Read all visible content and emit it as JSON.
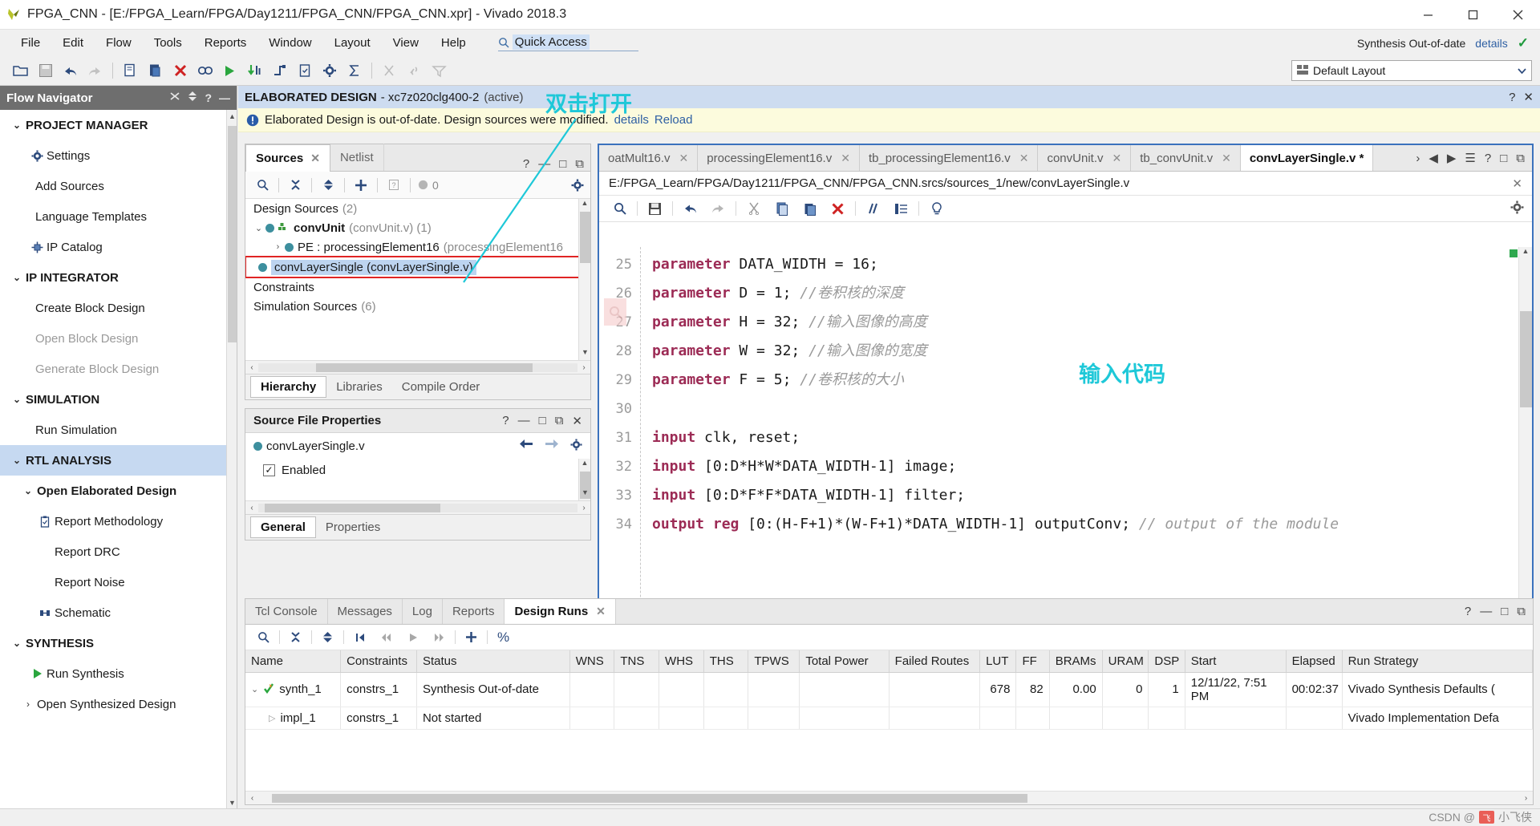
{
  "window": {
    "title": "FPGA_CNN - [E:/FPGA_Learn/FPGA/Day1211/FPGA_CNN/FPGA_CNN.xpr] - Vivado 2018.3",
    "minimize": "–",
    "maximize": "□",
    "close": "✕"
  },
  "menubar": {
    "items": [
      "File",
      "Edit",
      "Flow",
      "Tools",
      "Reports",
      "Window",
      "Layout",
      "View",
      "Help"
    ],
    "quick_access_value": "Quick Access",
    "synthesis_status": "Synthesis Out-of-date",
    "details_label": "details"
  },
  "toolbar": {
    "layout_label": "Default Layout"
  },
  "flow_navigator": {
    "header": "Flow Navigator",
    "sections": [
      {
        "label": "PROJECT MANAGER",
        "expanded": true,
        "items": [
          {
            "label": "Settings",
            "icon": "gear-icon",
            "disabled": false
          },
          {
            "label": "Add Sources",
            "icon": "",
            "disabled": false
          },
          {
            "label": "Language Templates",
            "icon": "",
            "disabled": false
          },
          {
            "label": "IP Catalog",
            "icon": "ip-icon",
            "disabled": false
          }
        ]
      },
      {
        "label": "IP INTEGRATOR",
        "expanded": true,
        "items": [
          {
            "label": "Create Block Design",
            "icon": "",
            "disabled": false
          },
          {
            "label": "Open Block Design",
            "icon": "",
            "disabled": true
          },
          {
            "label": "Generate Block Design",
            "icon": "",
            "disabled": true
          }
        ]
      },
      {
        "label": "SIMULATION",
        "expanded": true,
        "items": [
          {
            "label": "Run Simulation",
            "icon": "",
            "disabled": false
          }
        ]
      },
      {
        "label": "RTL ANALYSIS",
        "expanded": true,
        "selected": true,
        "items": [
          {
            "label": "Open Elaborated Design",
            "icon": "caret",
            "disabled": false,
            "bold": true
          },
          {
            "label": "Report Methodology",
            "icon": "clipboard-icon",
            "disabled": false
          },
          {
            "label": "Report DRC",
            "icon": "",
            "disabled": false
          },
          {
            "label": "Report Noise",
            "icon": "",
            "disabled": false
          },
          {
            "label": "Schematic",
            "icon": "schematic-icon",
            "disabled": false
          }
        ]
      },
      {
        "label": "SYNTHESIS",
        "expanded": true,
        "items": [
          {
            "label": "Run Synthesis",
            "icon": "run-icon",
            "disabled": false
          },
          {
            "label": "Open Synthesized Design",
            "icon": "caret",
            "disabled": false
          }
        ]
      }
    ]
  },
  "elaborated_header": {
    "title": "ELABORATED DESIGN",
    "device": "- xc7z020clg400-2",
    "active": "(active)"
  },
  "warning_bar": {
    "message": "Elaborated Design is out-of-date. Design sources were modified.",
    "details_label": "details",
    "reload_label": "Reload"
  },
  "sources_panel": {
    "tabs": [
      {
        "label": "Sources",
        "active": true,
        "closable": true
      },
      {
        "label": "Netlist",
        "active": false,
        "closable": false
      }
    ],
    "toolbar_badge": "0",
    "tree": [
      {
        "label": "Design Sources",
        "count": "(2)",
        "indent": 0,
        "arrow": "",
        "dot": false
      },
      {
        "label": "convUnit",
        "sub": "(convUnit.v) (1)",
        "indent": 0,
        "arrow": "v",
        "dot": true,
        "bold": true,
        "module": true
      },
      {
        "label": "PE : processingElement16",
        "sub": "(processingElement16",
        "indent": 1,
        "arrow": ">",
        "dot": true
      },
      {
        "label": "convLayerSingle (convLayerSingle.v)",
        "sub": "",
        "indent": 0,
        "arrow": "",
        "dot": true,
        "selected": true,
        "highlighted": true
      },
      {
        "label": "Constraints",
        "sub": "",
        "indent": 0,
        "arrow": "",
        "dot": false
      },
      {
        "label": "Simulation Sources",
        "count": "(6)",
        "indent": 0,
        "arrow": "",
        "dot": false
      }
    ],
    "subtabs": [
      {
        "label": "Hierarchy",
        "active": true
      },
      {
        "label": "Libraries",
        "active": false
      },
      {
        "label": "Compile Order",
        "active": false
      }
    ]
  },
  "properties_panel": {
    "title": "Source File Properties",
    "file_name": "convLayerSingle.v",
    "enabled_label": "Enabled",
    "enabled_checked": true,
    "subtabs": [
      {
        "label": "General",
        "active": true
      },
      {
        "label": "Properties",
        "active": false
      }
    ]
  },
  "editor": {
    "tabs": [
      {
        "label": "oatMult16.v",
        "active": false,
        "modified": false
      },
      {
        "label": "processingElement16.v",
        "active": false,
        "modified": false
      },
      {
        "label": "tb_processingElement16.v",
        "active": false,
        "modified": false
      },
      {
        "label": "convUnit.v",
        "active": false,
        "modified": false
      },
      {
        "label": "tb_convUnit.v",
        "active": false,
        "modified": false
      },
      {
        "label": "convLayerSingle.v *",
        "active": true,
        "modified": true
      }
    ],
    "file_path": "E:/FPGA_Learn/FPGA/Day1211/FPGA_CNN/FPGA_CNN.srcs/sources_1/new/convLayerSingle.v",
    "lines": [
      {
        "no": "25",
        "parts": [
          {
            "t": "parameter",
            "c": "kw"
          },
          {
            "t": " DATA_WIDTH = 16;",
            "c": ""
          }
        ]
      },
      {
        "no": "26",
        "parts": [
          {
            "t": "parameter",
            "c": "kw"
          },
          {
            "t": " D = 1; ",
            "c": ""
          },
          {
            "t": "//卷积核的深度",
            "c": "cmt"
          }
        ]
      },
      {
        "no": "27",
        "parts": [
          {
            "t": "parameter",
            "c": "kw"
          },
          {
            "t": " H = 32; ",
            "c": ""
          },
          {
            "t": "//输入图像的高度",
            "c": "cmt"
          }
        ]
      },
      {
        "no": "28",
        "parts": [
          {
            "t": "parameter",
            "c": "kw"
          },
          {
            "t": " W = 32; ",
            "c": ""
          },
          {
            "t": "//输入图像的宽度",
            "c": "cmt"
          }
        ]
      },
      {
        "no": "29",
        "parts": [
          {
            "t": "parameter",
            "c": "kw"
          },
          {
            "t": " F = 5; ",
            "c": ""
          },
          {
            "t": "//卷积核的大小",
            "c": "cmt"
          }
        ]
      },
      {
        "no": "30",
        "parts": [
          {
            "t": "",
            "c": ""
          }
        ]
      },
      {
        "no": "31",
        "parts": [
          {
            "t": "input",
            "c": "kw"
          },
          {
            "t": " clk, reset;",
            "c": ""
          }
        ]
      },
      {
        "no": "32",
        "parts": [
          {
            "t": "input",
            "c": "kw"
          },
          {
            "t": " [0:D*H*W*DATA_WIDTH-1] image;",
            "c": ""
          }
        ]
      },
      {
        "no": "33",
        "parts": [
          {
            "t": "input",
            "c": "kw"
          },
          {
            "t": " [0:D*F*F*DATA_WIDTH-1] filter;",
            "c": ""
          }
        ]
      },
      {
        "no": "34",
        "parts": [
          {
            "t": "output reg",
            "c": "kw"
          },
          {
            "t": " [0:(H-F+1)*(W-F+1)*DATA_WIDTH-1] outputConv; ",
            "c": ""
          },
          {
            "t": "// output of the module",
            "c": "cmt"
          }
        ]
      }
    ]
  },
  "bottom_panel": {
    "tabs": [
      {
        "label": "Tcl Console",
        "active": false,
        "closable": false
      },
      {
        "label": "Messages",
        "active": false,
        "closable": false
      },
      {
        "label": "Log",
        "active": false,
        "closable": false
      },
      {
        "label": "Reports",
        "active": false,
        "closable": false
      },
      {
        "label": "Design Runs",
        "active": true,
        "closable": true
      }
    ],
    "table": {
      "columns": [
        "Name",
        "Constraints",
        "Status",
        "WNS",
        "TNS",
        "WHS",
        "THS",
        "TPWS",
        "Total Power",
        "Failed Routes",
        "LUT",
        "FF",
        "BRAMs",
        "URAM",
        "DSP",
        "Start",
        "Elapsed",
        "Run Strategy"
      ],
      "rows": [
        {
          "name": "synth_1",
          "arrow": "v",
          "icon": "synth-icon",
          "indent": 0,
          "cells": [
            "constrs_1",
            "Synthesis Out-of-date",
            "",
            "",
            "",
            "",
            "",
            "",
            "",
            "678",
            "82",
            "0.00",
            "0",
            "1",
            "12/11/22, 7:51 PM",
            "00:02:37",
            "Vivado Synthesis Defaults ("
          ]
        },
        {
          "name": "impl_1",
          "arrow": ">",
          "icon": "",
          "indent": 1,
          "cells": [
            "constrs_1",
            "Not started",
            "",
            "",
            "",
            "",
            "",
            "",
            "",
            "",
            "",
            "",
            "",
            "",
            "",
            "",
            "Vivado Implementation Defa"
          ]
        }
      ]
    }
  },
  "annotations": {
    "open_hint": "双击打开",
    "code_hint": "输入代码"
  },
  "watermark": {
    "prefix": "CSDN @",
    "text": "小飞侠"
  },
  "colors": {
    "accent": "#3b72bd",
    "selection": "#bdd4f0",
    "warn_bg": "#fcfbdd",
    "annotation": "#1ec8d8",
    "highlight_box": "#e02424"
  }
}
